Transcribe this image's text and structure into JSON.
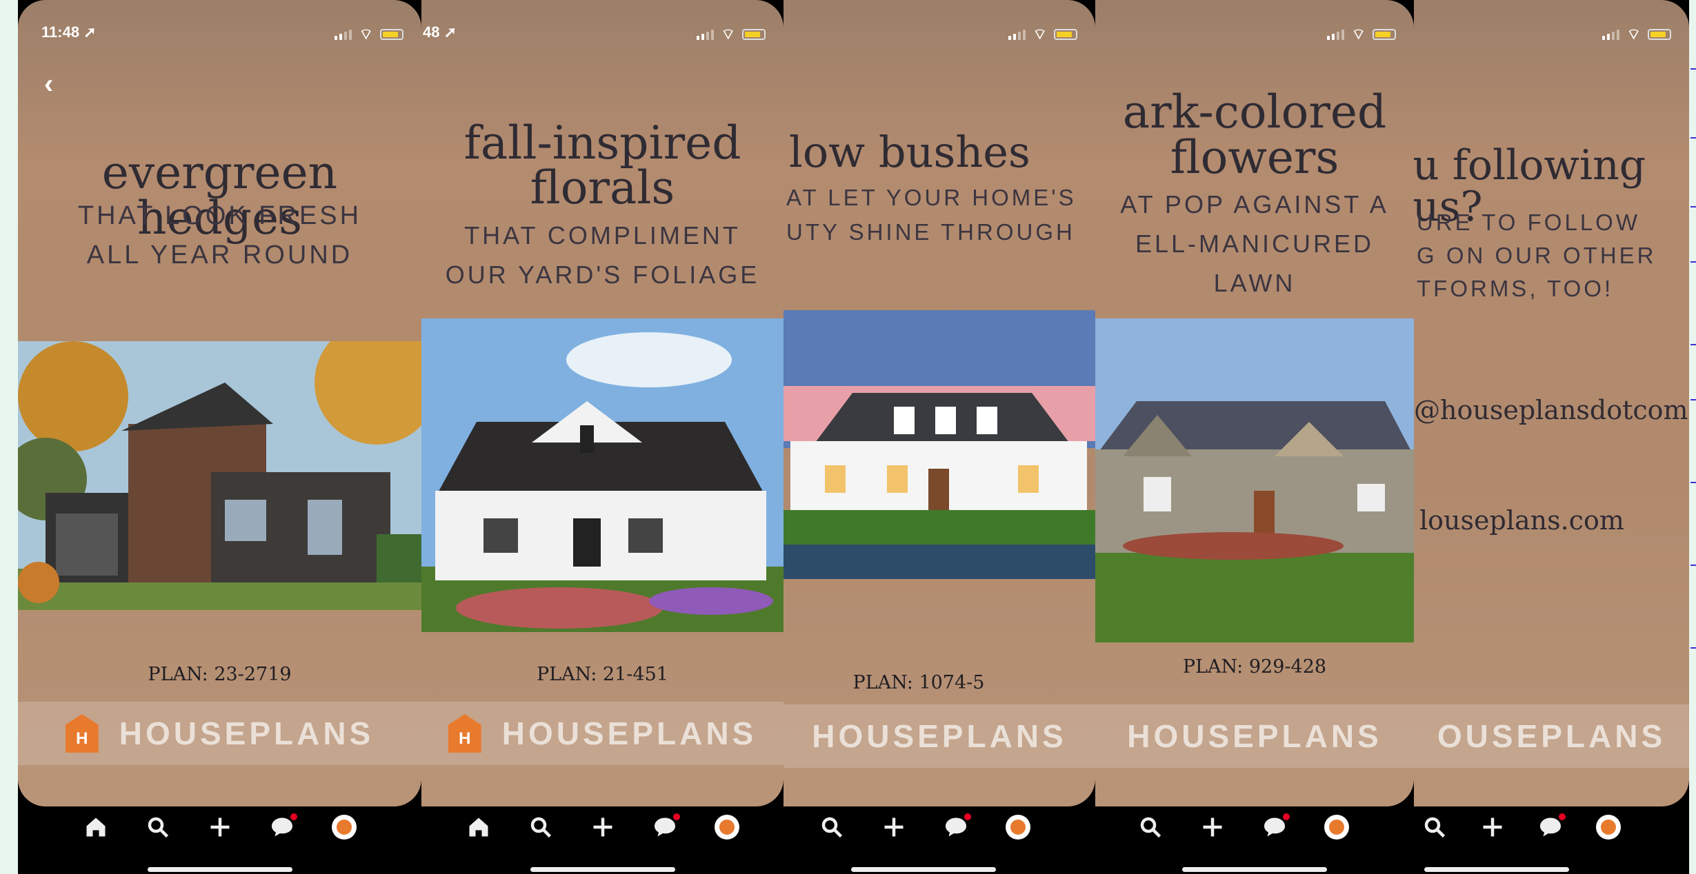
{
  "colors": {
    "card_bg": "#b18a6e",
    "headline": "#2f2b33",
    "logo_orange": "#e87a2e",
    "notification": "#e60023"
  },
  "screens": [
    {
      "time": "11:48 ➚",
      "back": "‹",
      "headline": [
        "evergreen hedges"
      ],
      "sub": [
        "THAT LOOK FRESH",
        "ALL YEAR ROUND"
      ],
      "plan": "PLAN: 23-2719",
      "brand": "HOUSEPLANS"
    },
    {
      "time": "48 ➚",
      "headline": [
        "fall-inspired",
        "florals"
      ],
      "sub": [
        "THAT COMPLIMENT",
        "OUR YARD'S FOLIAGE"
      ],
      "plan": "PLAN: 21-451",
      "brand": "HOUSEPLANS"
    },
    {
      "headline": [
        "low bushes"
      ],
      "sub": [
        "AT LET YOUR HOME'S",
        "UTY SHINE THROUGH"
      ],
      "plan": "PLAN: 1074-5",
      "brand": "HOUSEPLANS"
    },
    {
      "headline": [
        "ark-colored",
        "flowers"
      ],
      "sub": [
        "AT POP AGAINST A",
        "ELL-MANICURED",
        "LAWN"
      ],
      "plan": "PLAN: 929-428",
      "brand": "HOUSEPLANS"
    },
    {
      "headline": [
        "u following us?"
      ],
      "sub": [
        "URE TO FOLLOW",
        "G ON OUR OTHER",
        "TFORMS, TOO!"
      ],
      "handle": "@houseplansdotcom",
      "site": "louseplans.com",
      "brand": "OUSEPLANS"
    }
  ],
  "nav_icons": [
    "home-icon",
    "search-icon",
    "plus-icon",
    "chat-icon",
    "profile-icon"
  ]
}
